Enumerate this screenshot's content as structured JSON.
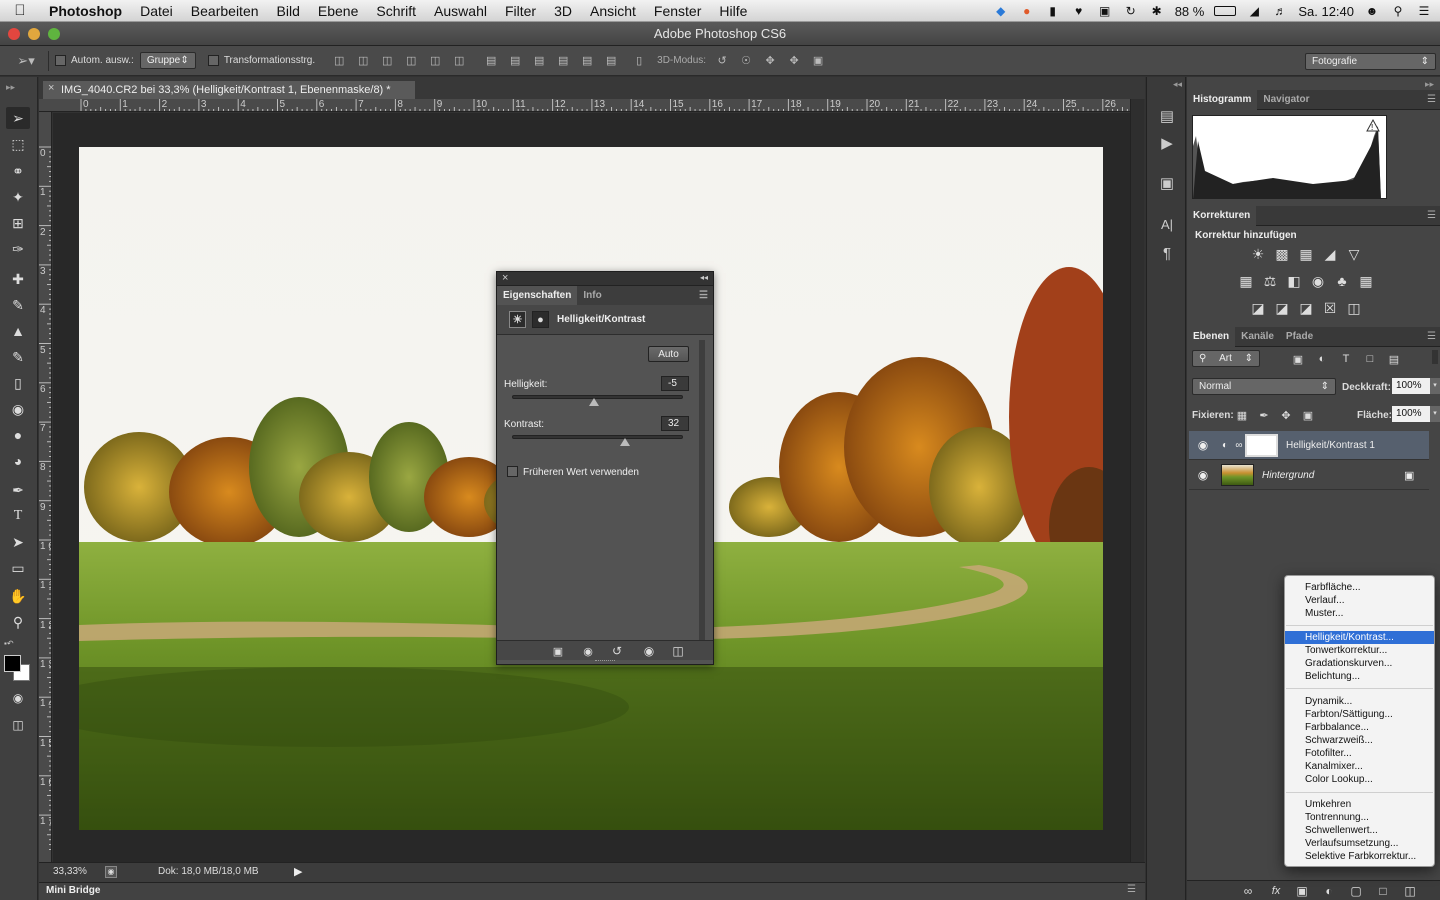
{
  "menubar": {
    "items": [
      "Photoshop",
      "Datei",
      "Bearbeiten",
      "Bild",
      "Ebene",
      "Schrift",
      "Auswahl",
      "Filter",
      "3D",
      "Ansicht",
      "Fenster",
      "Hilfe"
    ],
    "battery": "88 %",
    "clock": "Sa. 12:40"
  },
  "window": {
    "title": "Adobe Photoshop CS6"
  },
  "options": {
    "auto_select_label": "Autom. ausw.:",
    "auto_select_value": "Gruppe",
    "transform_label": "Transformationsstrg.",
    "mode_3d_label": "3D-Modus:",
    "workspace": "Fotografie"
  },
  "document": {
    "tab_title": "IMG_4040.CR2 bei 33,3% (Helligkeit/Kontrast 1, Ebenenmaske/8) *",
    "zoom": "33,33%",
    "doc_info": "Dok: 18,0 MB/18,0 MB",
    "ruler_h": [
      "0",
      "1",
      "2",
      "3",
      "4",
      "5",
      "6",
      "7",
      "8",
      "9",
      "10",
      "11",
      "12",
      "13",
      "14",
      "15",
      "16",
      "17",
      "18",
      "19",
      "20",
      "21",
      "22",
      "23",
      "24",
      "25",
      "26"
    ],
    "ruler_v": [
      "0",
      "1",
      "2",
      "3",
      "4",
      "5",
      "6",
      "7",
      "8",
      "9",
      "1 0",
      "1 1",
      "1 2",
      "1 3",
      "1 4",
      "1 5",
      "1 6",
      "1 7"
    ],
    "mini_bridge": "Mini Bridge"
  },
  "properties": {
    "tab_properties": "Eigenschaften",
    "tab_info": "Info",
    "adjustment_title": "Helligkeit/Kontrast",
    "auto_button": "Auto",
    "brightness_label": "Helligkeit:",
    "brightness_value": "-5",
    "brightness_level": 0.48,
    "contrast_label": "Kontrast:",
    "contrast_value": "32",
    "contrast_level": 0.66,
    "legacy_label": "Früheren Wert verwenden"
  },
  "panels": {
    "histogram_tab": "Histogramm",
    "navigator_tab": "Navigator",
    "corrections_tab": "Korrekturen",
    "add_correction": "Korrektur hinzufügen",
    "layers_tab": "Ebenen",
    "channels_tab": "Kanäle",
    "paths_tab": "Pfade",
    "filter_kind": "Art",
    "blend_mode": "Normal",
    "opacity_label": "Deckkraft:",
    "opacity_value": "100%",
    "lock_label": "Fixieren:",
    "fill_label": "Fläche:",
    "fill_value": "100%",
    "layers": [
      {
        "name": "Helligkeit/Kontrast 1"
      },
      {
        "name": "Hintergrund"
      }
    ]
  },
  "add_menu": {
    "group1": [
      "Farbfläche...",
      "Verlauf...",
      "Muster..."
    ],
    "group2": [
      "Helligkeit/Kontrast...",
      "Tonwertkorrektur...",
      "Gradationskurven...",
      "Belichtung..."
    ],
    "group3": [
      "Dynamik...",
      "Farbton/Sättigung...",
      "Farbbalance...",
      "Schwarzweiß...",
      "Fotofilter...",
      "Kanalmixer...",
      "Color Lookup..."
    ],
    "group4": [
      "Umkehren",
      "Tontrennung...",
      "Schwellenwert...",
      "Verlaufsumsetzung...",
      "Selektive Farbkorrektur..."
    ]
  }
}
